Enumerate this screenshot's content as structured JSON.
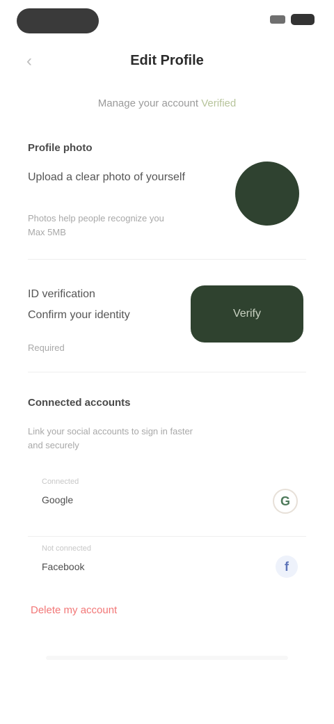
{
  "header": {
    "title": "Edit Profile",
    "back_icon": "chevron-left-icon"
  },
  "subtitle": {
    "text": "Manage your account",
    "accent": "Verified"
  },
  "profile": {
    "section_title": "Profile photo",
    "line1": "Upload a clear photo of yourself",
    "line2": "Photos help people recognize you",
    "line3": "Max 5MB"
  },
  "verification": {
    "line1": "ID verification",
    "line2": "Confirm your identity",
    "line3": "Required",
    "button_label": "Verify"
  },
  "connected": {
    "section_title": "Connected accounts",
    "desc_line1": "Link your social accounts to sign in faster",
    "desc_line2": "and securely",
    "items": [
      {
        "status": "Connected",
        "label": "Google",
        "icon": "G"
      },
      {
        "status": "Not connected",
        "label": "Facebook",
        "icon": "f"
      }
    ]
  },
  "danger": {
    "delete_label": "Delete my account"
  },
  "colors": {
    "dark_green": "#2f422f",
    "accent_green": "#b7c49b",
    "danger": "#f27777"
  }
}
